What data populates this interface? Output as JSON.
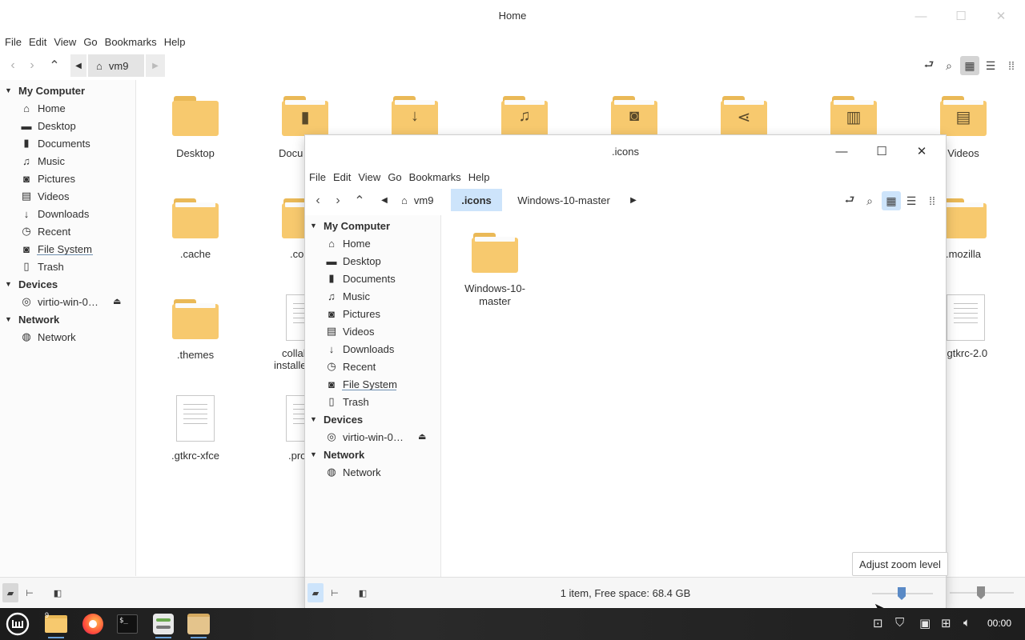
{
  "home": {
    "title": "Home",
    "menu": [
      "File",
      "Edit",
      "View",
      "Go",
      "Bookmarks",
      "Help"
    ],
    "crumb": "vm9",
    "sidebar": {
      "my_computer": "My Computer",
      "items": [
        "Home",
        "Desktop",
        "Documents",
        "Music",
        "Pictures",
        "Videos",
        "Downloads",
        "Recent",
        "File System",
        "Trash"
      ],
      "devices": "Devices",
      "device": "virtio-win-0…",
      "network_head": "Network",
      "network": "Network"
    },
    "files": {
      "desktop": "Desktop",
      "documents_partial": "Docu",
      "videos": "Videos",
      "cache": ".cache",
      "co_partial": ".co",
      "mozilla": ".mozilla",
      "themes": ".themes",
      "collab_partial_1": "collal",
      "collab_partial_2": "installe",
      "gtkrc2": ".gtkrc-2.0",
      "gtkrc_xfce": ".gtkrc-xfce",
      "pro_partial": ".pro"
    }
  },
  "icons_window": {
    "title": ".icons",
    "menu": [
      "File",
      "Edit",
      "View",
      "Go",
      "Bookmarks",
      "Help"
    ],
    "crumbs": [
      "vm9",
      ".icons",
      "Windows-10-master"
    ],
    "sidebar": {
      "my_computer": "My Computer",
      "items": [
        "Home",
        "Desktop",
        "Documents",
        "Music",
        "Pictures",
        "Videos",
        "Downloads",
        "Recent",
        "File System",
        "Trash"
      ],
      "devices": "Devices",
      "device": "virtio-win-0…",
      "network_head": "Network",
      "network": "Network"
    },
    "file_line1": "Windows-10-",
    "file_line2": "master",
    "status": "1 item, Free space: 68.4 GB"
  },
  "tooltip": "Adjust zoom level",
  "taskbar": {
    "clock": "00:00",
    "workspace_badge": "9"
  },
  "colors": {
    "accent": "#cde4fb",
    "folder": "#f7c96e",
    "knob": "#5a8ac6"
  }
}
